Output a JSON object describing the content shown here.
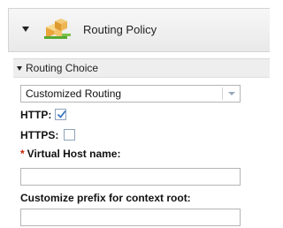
{
  "header": {
    "title": "Routing Policy",
    "icon": "routing-policy-icon"
  },
  "section": {
    "title": "Routing Choice"
  },
  "routing_select": {
    "value": "Customized Routing"
  },
  "http": {
    "label": "HTTP:",
    "checked": true
  },
  "https": {
    "label": "HTTPS:",
    "checked": false
  },
  "virtual_host": {
    "required_marker": "*",
    "label": "Virtual Host name:",
    "value": ""
  },
  "context_root": {
    "label": "Customize prefix for context root:",
    "value": ""
  },
  "colors": {
    "required": "#cc2200",
    "check": "#3a78c2",
    "field_border": "#b5b5b5"
  }
}
